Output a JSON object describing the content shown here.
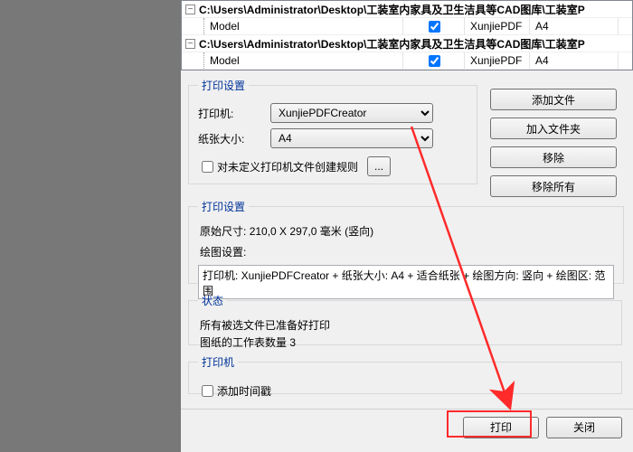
{
  "tree": {
    "path1": "C:\\Users\\Administrator\\Desktop\\工装室内家具及卫生洁具等CAD图库\\工装室P",
    "leaf": {
      "name": "Model",
      "conv": "XunjiePDF",
      "paper": "A4"
    },
    "path2": "C:\\Users\\Administrator\\Desktop\\工装室内家具及卫生洁具等CAD图库\\工装室P",
    "leaf2": {
      "name": "Model",
      "conv": "XunjiePDF",
      "paper": "A4"
    }
  },
  "grpPrint": {
    "legend": "打印设置",
    "printerLabel": "打印机:",
    "printerValue": "XunjiePDFCreator",
    "paperLabel": "纸张大小:",
    "paperValue": "A4",
    "ruleCheckbox": "对未定义打印机文件创建规则",
    "ellipsis": "..."
  },
  "sideButtons": {
    "add": "添加文件",
    "addFolder": "加入文件夹",
    "remove": "移除",
    "removeAll": "移除所有"
  },
  "grpPrint2": {
    "legend": "打印设置",
    "origLabel": "原始尺寸:",
    "origVal": "210,0 X 297,0 毫米 (竖向)",
    "drawLabel": "绘图设置:",
    "summary": "打印机: XunjiePDFCreator + 纸张大小: A4 + 适合纸张 + 绘图方向: 竖向 + 绘图区: 范围"
  },
  "grpStatus": {
    "legend": "状态",
    "line1": "所有被选文件已准备好打印",
    "line2": "图纸的工作表数量 3"
  },
  "grpPrinter": {
    "legend": "打印机",
    "delayCheckbox": "添加时间戳"
  },
  "bottom": {
    "print": "打印",
    "close": "关闭"
  }
}
